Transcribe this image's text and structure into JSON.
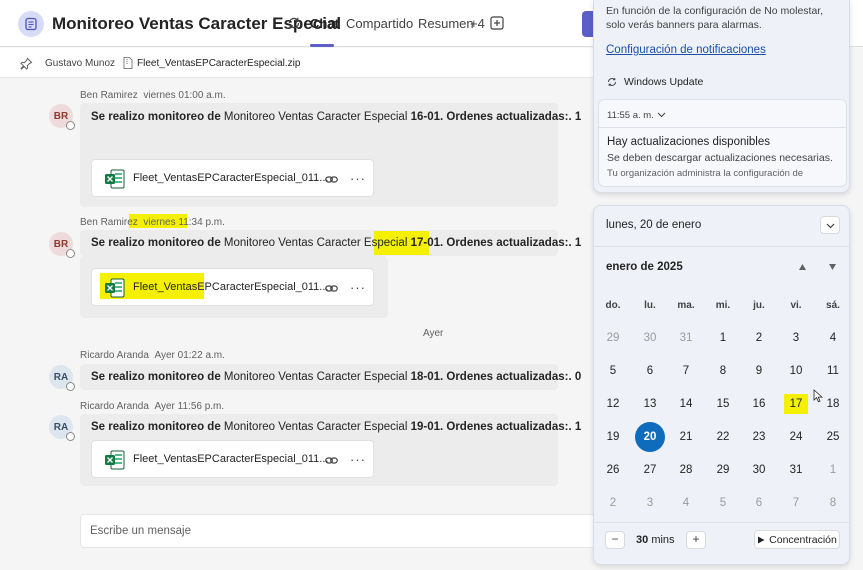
{
  "header": {
    "title": "Monitoreo Ventas Caracter Especial",
    "tabs": [
      {
        "label": "Chat"
      },
      {
        "label": "Compartido"
      },
      {
        "label": "Resumen"
      },
      {
        "label": "+4"
      }
    ]
  },
  "pinned": {
    "user": "Gustavo Munoz",
    "file": "Fleet_VentasEPCaracterEspecial.zip"
  },
  "messages": [
    {
      "sender": "Ben Ramirez",
      "time": "viernes 01:00 a.m.",
      "initials": "BR",
      "bold_a": "Se realizo monitoreo de ",
      "normal": "Monitoreo Ventas Caracter Especial ",
      "bold_b": "16-01. Ordenes actualizadas:. 1",
      "file": "Fleet_VentasEPCaracterEspecial_011..."
    },
    {
      "sender": "Ben Ramirez",
      "time": "viernes 11:34 p.m.",
      "initials": "BR",
      "bold_a": "Se realizo monitoreo de ",
      "normal": "Monitoreo Ventas Caracter Especial ",
      "bold_b": "17-01. Ordenes actualizadas:. 1",
      "file": "Fleet_VentasEPCaracterEspecial_011..."
    },
    {
      "sender": "Ricardo Aranda",
      "time": "Ayer 01:22 a.m.",
      "initials": "RA",
      "bold_a": "Se realizo monitoreo de ",
      "normal": "Monitoreo Ventas Caracter Especial ",
      "bold_b": "18-01. Ordenes actualizadas:. 0"
    },
    {
      "sender": "Ricardo Aranda",
      "time": "Ayer 11:56 p.m.",
      "initials": "RA",
      "bold_a": "Se realizo monitoreo de ",
      "normal": "Monitoreo Ventas Caracter Especial ",
      "bold_b": "19-01. Ordenes actualizadas:. 1",
      "file": "Fleet_VentasEPCaracterEspecial_011..."
    }
  ],
  "day_divider": "Ayer",
  "compose": {
    "placeholder": "Escribe un mensaje"
  },
  "notifications": {
    "dnd_text": "En función de la configuración de No molestar, solo verás banners para alarmas.",
    "settings_link": "Configuración de notificaciones",
    "group_label": "Windows Update",
    "card": {
      "time": "11:55 a. m.",
      "title": "Hay actualizaciones disponibles",
      "body": "Se deben descargar actualizaciones necesarias.",
      "footer": "Tu organización administra la configuración de"
    }
  },
  "calendar": {
    "full_date": "lunes, 20 de enero",
    "month_label": "enero de 2025",
    "weekdays": [
      "do.",
      "lu.",
      "ma.",
      "mi.",
      "ju.",
      "vi.",
      "sá."
    ],
    "weeks": [
      [
        {
          "d": "29",
          "dim": true
        },
        {
          "d": "30",
          "dim": true
        },
        {
          "d": "31",
          "dim": true
        },
        {
          "d": "1"
        },
        {
          "d": "2"
        },
        {
          "d": "3"
        },
        {
          "d": "4"
        }
      ],
      [
        {
          "d": "5"
        },
        {
          "d": "6"
        },
        {
          "d": "7"
        },
        {
          "d": "8"
        },
        {
          "d": "9"
        },
        {
          "d": "10"
        },
        {
          "d": "11"
        }
      ],
      [
        {
          "d": "12"
        },
        {
          "d": "13"
        },
        {
          "d": "14"
        },
        {
          "d": "15"
        },
        {
          "d": "16"
        },
        {
          "d": "17",
          "highlight": true
        },
        {
          "d": "18"
        }
      ],
      [
        {
          "d": "19"
        },
        {
          "d": "20",
          "today": true
        },
        {
          "d": "21"
        },
        {
          "d": "22"
        },
        {
          "d": "23"
        },
        {
          "d": "24"
        },
        {
          "d": "25"
        }
      ],
      [
        {
          "d": "26"
        },
        {
          "d": "27"
        },
        {
          "d": "28"
        },
        {
          "d": "29"
        },
        {
          "d": "30"
        },
        {
          "d": "31"
        },
        {
          "d": "1",
          "dim": true
        }
      ],
      [
        {
          "d": "2",
          "dim": true
        },
        {
          "d": "3",
          "dim": true
        },
        {
          "d": "4",
          "dim": true
        },
        {
          "d": "5",
          "dim": true
        },
        {
          "d": "6",
          "dim": true
        },
        {
          "d": "7",
          "dim": true
        },
        {
          "d": "8",
          "dim": true
        }
      ]
    ],
    "focus": {
      "minus": "−",
      "value": "30",
      "unit": "mins",
      "plus": "+",
      "button": "Concentración"
    }
  },
  "colors": {
    "accent": "#5b5fc7",
    "today": "#0f6cbd",
    "highlight": "#f4f000",
    "link": "#1a4fa8"
  }
}
